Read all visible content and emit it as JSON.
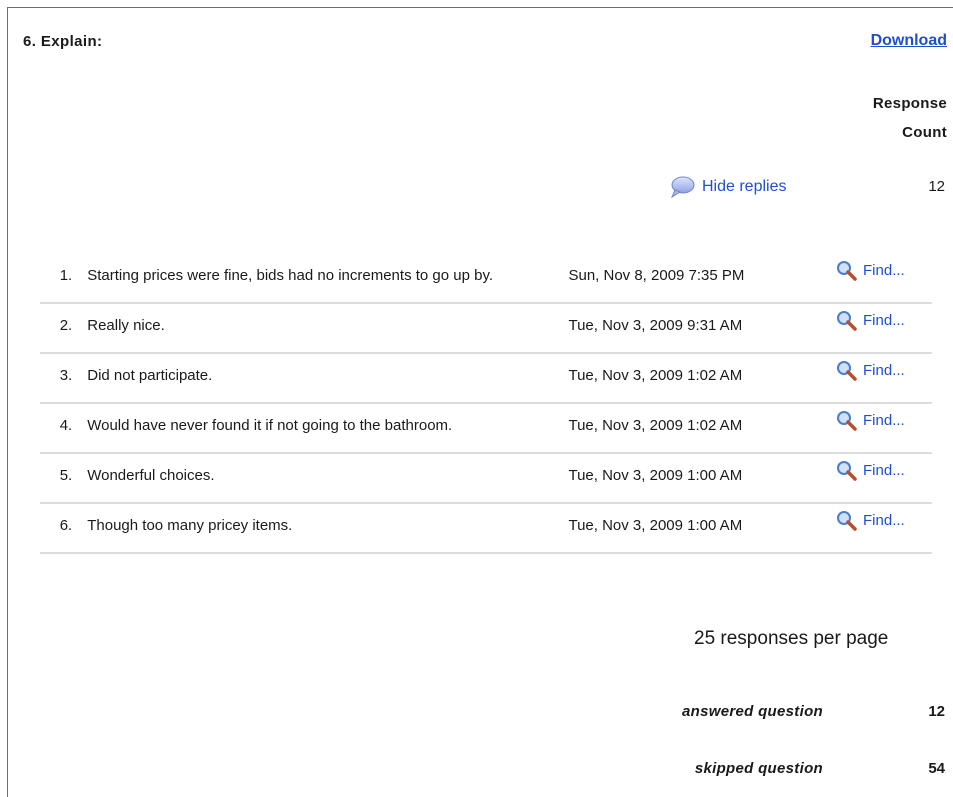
{
  "question": {
    "title": "6. Explain:",
    "download_label": "Download"
  },
  "response_count_header": {
    "line1": "Response",
    "line2": "Count"
  },
  "hide_replies_label": "Hide replies",
  "response_count_value": "12",
  "replies": [
    {
      "num": "1.",
      "text": "Starting prices were fine, bids had no increments to go up by.",
      "date": "Sun, Nov 8, 2009 7:35 PM",
      "find": "Find..."
    },
    {
      "num": "2.",
      "text": "Really nice.",
      "date": "Tue, Nov 3, 2009 9:31 AM",
      "find": "Find..."
    },
    {
      "num": "3.",
      "text": "Did not participate.",
      "date": "Tue, Nov 3, 2009 1:02 AM",
      "find": "Find..."
    },
    {
      "num": "4.",
      "text": "Would have never found it if not going to the bathroom.",
      "date": "Tue, Nov 3, 2009 1:02 AM",
      "find": "Find..."
    },
    {
      "num": "5.",
      "text": "Wonderful choices.",
      "date": "Tue, Nov 3, 2009 1:00 AM",
      "find": "Find..."
    },
    {
      "num": "6.",
      "text": "Though too many pricey items.",
      "date": "Tue, Nov 3, 2009 1:00 AM",
      "find": "Find..."
    }
  ],
  "per_page_label": "25 responses per page",
  "stats": {
    "answered_label": "answered question",
    "answered_value": "12",
    "skipped_label": "skipped question",
    "skipped_value": "54"
  },
  "icons": {
    "hide_replies": "speech-bubble-icon",
    "find": "magnifier-icon"
  },
  "colors": {
    "link": "#1f4fcf",
    "row_divider": "#dcdcdc"
  }
}
